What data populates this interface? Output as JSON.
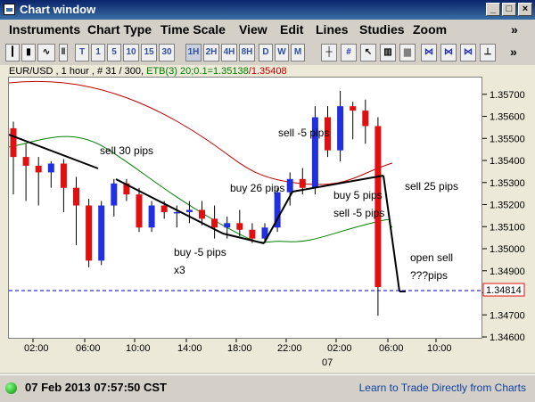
{
  "window": {
    "title": "Chart window",
    "btn_min": "_",
    "btn_max": "□",
    "btn_close": "×"
  },
  "menu": [
    {
      "label": "Instruments"
    },
    {
      "label": "Chart Type"
    },
    {
      "label": "Time Scale"
    },
    {
      "label": "View"
    },
    {
      "label": "Edit"
    },
    {
      "label": "Lines"
    },
    {
      "label": "Studies"
    },
    {
      "label": "Zoom"
    }
  ],
  "menu_overflow": "»",
  "toolbar": {
    "timeframes": [
      "T",
      "1",
      "5",
      "10",
      "15",
      "30",
      "1H",
      "2H",
      "4H",
      "8H",
      "D",
      "W",
      "M"
    ],
    "selected": "1H",
    "overflow": "»"
  },
  "legend": {
    "symbol": "EUR/USD , 1 hour , # 31 / 300,",
    "study": "ETB(3) 20;0.1=1.35138",
    "study_upper": "/1.35408"
  },
  "colors": {
    "up": "#2030e0",
    "down": "#e01010",
    "ma_green": "#008000",
    "ma_red": "#c00000",
    "price_line": "#0000c0",
    "accent": "#0a246a"
  },
  "chart_data": {
    "type": "candlestick",
    "ylim": [
      1.346,
      1.3578
    ],
    "y_ticks": [
      "1.35700",
      "1.35600",
      "1.35500",
      "1.35400",
      "1.35300",
      "1.35200",
      "1.35100",
      "1.35000",
      "1.34900",
      "1.34800",
      "1.34700",
      "1.34600"
    ],
    "x_ticks": [
      "02:00",
      "06:00",
      "10:00",
      "14:00",
      "18:00",
      "22:00",
      "02:00",
      "06:00",
      "10:00"
    ],
    "x_sub": "07",
    "current_price": "1.34814",
    "candles": [
      [
        1.3555,
        1.3558,
        1.3525,
        1.3542
      ],
      [
        1.3542,
        1.3548,
        1.3522,
        1.3538
      ],
      [
        1.3538,
        1.3542,
        1.352,
        1.3535
      ],
      [
        1.3535,
        1.354,
        1.3528,
        1.3539
      ],
      [
        1.3539,
        1.3541,
        1.3517,
        1.3528
      ],
      [
        1.3528,
        1.3533,
        1.3502,
        1.352
      ],
      [
        1.352,
        1.3523,
        1.3492,
        1.3495
      ],
      [
        1.3495,
        1.3522,
        1.3493,
        1.352
      ],
      [
        1.352,
        1.3532,
        1.3515,
        1.353
      ],
      [
        1.353,
        1.3532,
        1.3522,
        1.3525
      ],
      [
        1.3525,
        1.3528,
        1.3508,
        1.351
      ],
      [
        1.351,
        1.3522,
        1.3508,
        1.352
      ],
      [
        1.352,
        1.3522,
        1.3514,
        1.3517
      ],
      [
        1.3517,
        1.352,
        1.351,
        1.3517
      ],
      [
        1.3517,
        1.3522,
        1.3512,
        1.3518
      ],
      [
        1.3518,
        1.3522,
        1.3511,
        1.3514
      ],
      [
        1.3514,
        1.352,
        1.3505,
        1.351
      ],
      [
        1.351,
        1.3515,
        1.3505,
        1.3512
      ],
      [
        1.3512,
        1.3518,
        1.3506,
        1.3509
      ],
      [
        1.3509,
        1.3512,
        1.3503,
        1.3505
      ],
      [
        1.3505,
        1.3512,
        1.3504,
        1.351
      ],
      [
        1.351,
        1.3528,
        1.3508,
        1.3526
      ],
      [
        1.3526,
        1.3535,
        1.352,
        1.3532
      ],
      [
        1.3532,
        1.3537,
        1.3525,
        1.3528
      ],
      [
        1.3528,
        1.3565,
        1.3525,
        1.356
      ],
      [
        1.356,
        1.3565,
        1.3542,
        1.3545
      ],
      [
        1.3545,
        1.3572,
        1.354,
        1.3565
      ],
      [
        1.3565,
        1.3567,
        1.355,
        1.3563
      ],
      [
        1.3563,
        1.3568,
        1.3548,
        1.3556
      ],
      [
        1.3556,
        1.356,
        1.347,
        1.3483
      ]
    ],
    "annotations": [
      {
        "text": "sell 30 pips"
      },
      {
        "text": "buy 26 pips"
      },
      {
        "text": "buy -5 pips"
      },
      {
        "text": "x3"
      },
      {
        "text": "sell -5 pips"
      },
      {
        "text": "buy 5 pips"
      },
      {
        "text": "sell -5 pips"
      },
      {
        "text": "sell 25 pips"
      },
      {
        "text": "open sell"
      },
      {
        "text": "???pips"
      }
    ]
  },
  "status": {
    "time": "07 Feb 2013 07:57:50 CST",
    "link": "Learn to Trade Directly from Charts"
  }
}
